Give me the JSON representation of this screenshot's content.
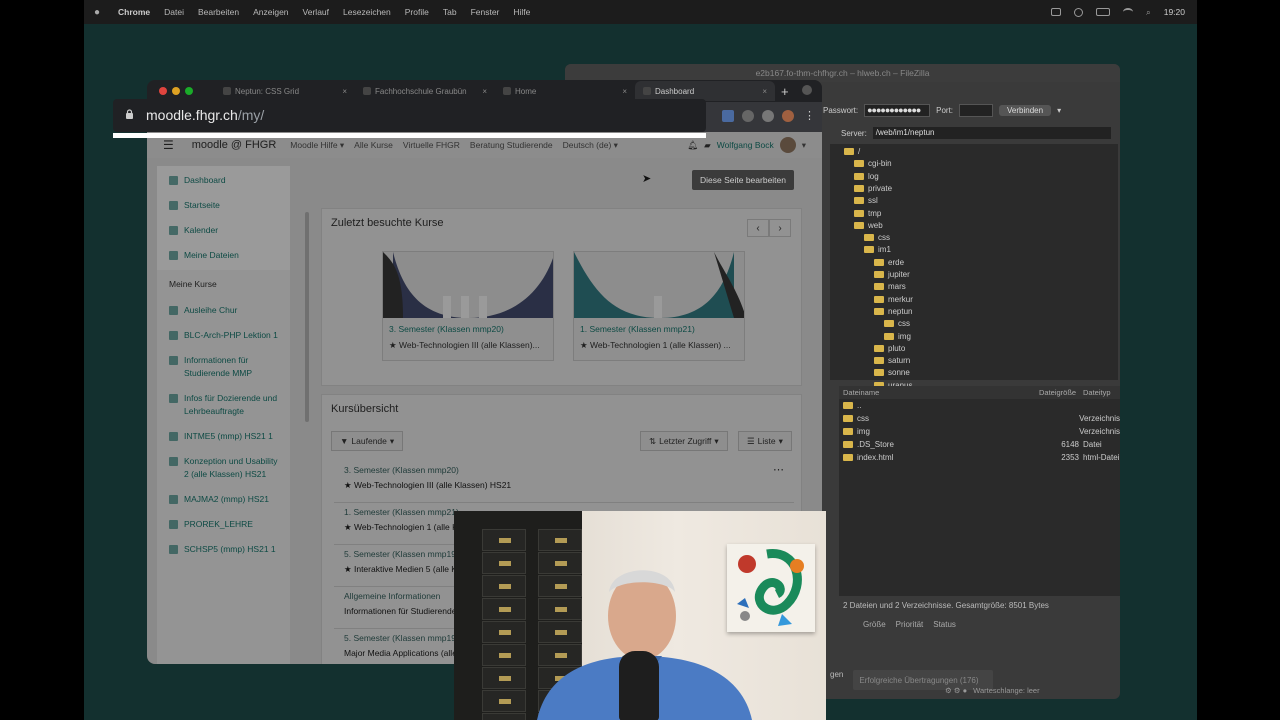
{
  "menubar": {
    "app": "Chrome",
    "items": [
      "Datei",
      "Bearbeiten",
      "Anzeigen",
      "Verlauf",
      "Lesezeichen",
      "Profile",
      "Tab",
      "Fenster",
      "Hilfe"
    ],
    "clock": "19:20"
  },
  "filezilla": {
    "title": "e2b167.fo-thm-chfhgr.ch – hlweb.ch – FileZilla",
    "password_label": "Passwort:",
    "password_value": "●●●●●●●●●●●●",
    "port_label": "Port:",
    "connect_label": "Verbinden",
    "server_label": "Server:",
    "server_path": "/web/im1/neptun",
    "tree": [
      "/",
      "cgi-bin",
      "log",
      "private",
      "ssl",
      "tmp",
      "web",
      "css",
      "im1",
      "erde",
      "jupiter",
      "mars",
      "merkur",
      "neptun",
      "css",
      "img",
      "pluto",
      "saturn",
      "sonne",
      "uranus"
    ],
    "list_headers": [
      "Dateiname",
      "Dateigröße",
      "Dateityp"
    ],
    "rows": [
      {
        "name": "..",
        "size": "",
        "type": ""
      },
      {
        "name": "css",
        "size": "",
        "type": "Verzeichnis"
      },
      {
        "name": "img",
        "size": "",
        "type": "Verzeichnis"
      },
      {
        "name": ".DS_Store",
        "size": "6148",
        "type": "Datei"
      },
      {
        "name": "index.html",
        "size": "2353",
        "type": "html-Datei"
      }
    ],
    "summary": "2 Dateien und 2 Verzeichnisse. Gesamtgröße: 8501 Bytes",
    "queue_headers": [
      "Größe",
      "Priorität",
      "Status"
    ],
    "tab_partial": "gen",
    "tab_success": "Erfolgreiche Übertragungen (176)",
    "queue_status": "Warteschlange: leer"
  },
  "chrome": {
    "tabs": [
      "Neptun: CSS Grid",
      "Fachhochschule Graubün",
      "Home",
      "Dashboard"
    ],
    "url_host": "moodle.fhgr.ch",
    "url_path": "/my/"
  },
  "moodle": {
    "brand": "moodle @ FHGR",
    "nav": [
      "Moodle Hilfe ▾",
      "Alle Kurse",
      "Virtuelle FHGR",
      "Beratung Studierende",
      "Deutsch (de) ▾"
    ],
    "user": "Wolfgang Bock",
    "drawer_top": [
      "Dashboard",
      "Startseite",
      "Kalender",
      "Meine Dateien"
    ],
    "my_courses_title": "Meine Kurse",
    "my_courses": [
      "Ausleihe Chur",
      "BLC-Arch-PHP Lektion 1",
      "Informationen für Studierende MMP",
      "Infos für Dozierende und Lehrbeauftragte",
      "INTME5 (mmp) HS21 1",
      "Konzeption und Usability 2 (alle Klassen) HS21",
      "MAJMA2 (mmp) HS21",
      "PROREK_LEHRE",
      "SCHSP5 (mmp) HS21 1"
    ],
    "edit_button": "Diese Seite bearbeiten",
    "recent_title": "Zuletzt besuchte Kurse",
    "recent": [
      {
        "category": "3. Semester (Klassen mmp20)",
        "name": "Web-Technologien III (alle Klassen)..."
      },
      {
        "category": "1. Semester (Klassen mmp21)",
        "name": "Web-Technologien 1 (alle Klassen) ..."
      }
    ],
    "overview_title": "Kursübersicht",
    "filter_label": "Laufende",
    "sort_label": "Letzter Zugriff",
    "view_label": "Liste",
    "overview_rows": [
      {
        "category": "3. Semester (Klassen mmp20)",
        "name": "Web-Technologien III (alle Klassen) HS21"
      },
      {
        "category": "1. Semester (Klassen mmp21)",
        "name": "Web-Technologien 1 (alle Klassen) HS21"
      },
      {
        "category": "5. Semester (Klassen mmp19)",
        "name": "Interaktive Medien 5 (alle Klassen) HS21"
      },
      {
        "category": "Allgemeine Informationen",
        "name": "Informationen für Studierende MMP"
      },
      {
        "category": "5. Semester (Klassen mmp19)",
        "name": "Major Media Applications (alle Klassen) HS21"
      }
    ]
  }
}
